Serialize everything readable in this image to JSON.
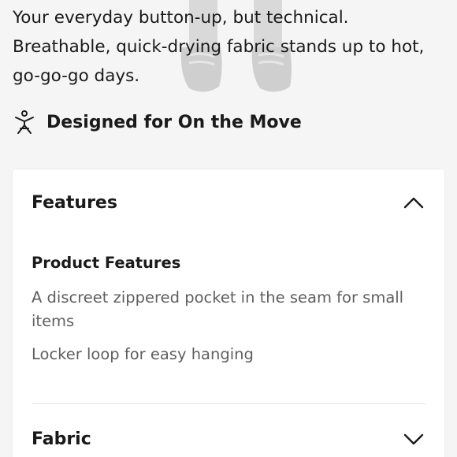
{
  "intro": {
    "description": "Your everyday button-up, but technical. Breathable, quick-drying fabric stands up to hot, go-go-go days."
  },
  "activity": {
    "icon": "person-stretch-icon",
    "label": "Designed for On the Move"
  },
  "accordion": {
    "features": {
      "title": "Features",
      "expanded": true,
      "icon": "chevron-up-icon",
      "subheading": "Product Features",
      "items": [
        "A discreet zippered pocket in the seam for small items",
        "Locker loop for easy hanging"
      ]
    },
    "fabric": {
      "title": "Fabric",
      "expanded": false,
      "icon": "chevron-down-icon"
    }
  },
  "colors": {
    "background": "#f5f5f5",
    "card": "#ffffff",
    "text": "#1a1a1a",
    "muted_text": "#5f5f5f",
    "divider": "#e4e4e4"
  }
}
